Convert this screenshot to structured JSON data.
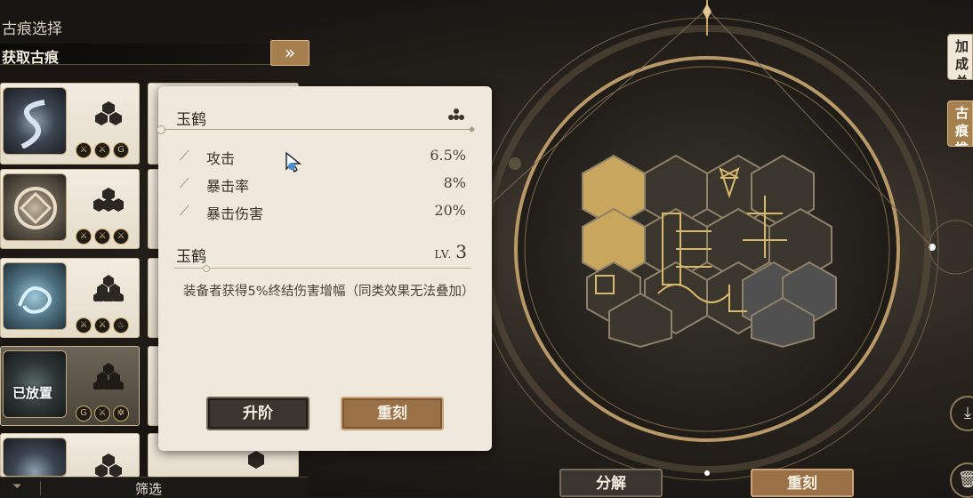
{
  "left_panel": {
    "title": "古痕选择",
    "acquire_label": "获取古痕",
    "acquire_button_icon": "»",
    "placed_label": "已放置",
    "filter_label": "筛选"
  },
  "popup": {
    "title": "玉鹤",
    "stats": [
      {
        "name": "攻击",
        "value": "6.5%"
      },
      {
        "name": "暴击率",
        "value": "8%"
      },
      {
        "name": "暴击伤害",
        "value": "20%"
      }
    ],
    "item_name": "玉鹤",
    "level_label": "LV.",
    "level_value": "3",
    "description": "装备者获得5%终结伤害增幅（同类效果无法叠加）",
    "upgrade_button": "升阶",
    "reforge_button": "重刻"
  },
  "right_panel": {
    "tab_bonus": "加成总览",
    "tab_recommend": "古痕推荐",
    "decompose_button": "分解",
    "reforge_button": "重刻"
  },
  "colors": {
    "gold": "#a67f4e",
    "popup_bg": "#efe9dd",
    "dark_button": "#3a352e"
  }
}
